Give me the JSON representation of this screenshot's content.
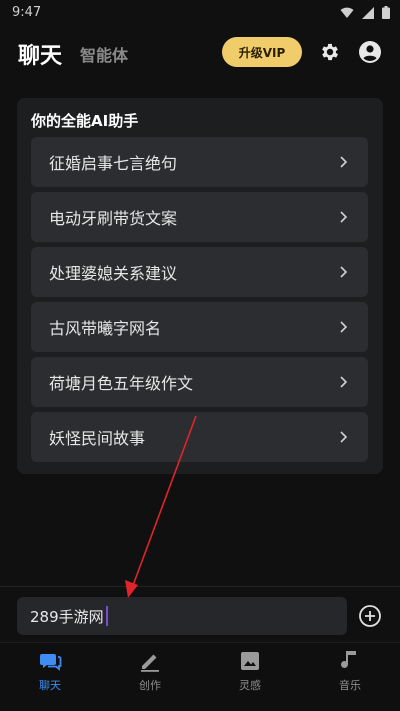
{
  "status_bar": {
    "time": "9:47"
  },
  "header": {
    "tab_chat": "聊天",
    "tab_agent": "智能体",
    "vip_label": "升级VIP"
  },
  "assistant": {
    "title": "你的全能AI助手",
    "items": [
      {
        "label": "征婚启事七言绝句"
      },
      {
        "label": "电动牙刷带货文案"
      },
      {
        "label": "处理婆媳关系建议"
      },
      {
        "label": "古风带曦字网名"
      },
      {
        "label": "荷塘月色五年级作文"
      },
      {
        "label": "妖怪民间故事"
      }
    ]
  },
  "input": {
    "value": "289手游网"
  },
  "nav": {
    "items": [
      {
        "label": "聊天",
        "icon": "chat-icon",
        "active": true
      },
      {
        "label": "创作",
        "icon": "pencil-icon",
        "active": false
      },
      {
        "label": "灵感",
        "icon": "image-icon",
        "active": false
      },
      {
        "label": "音乐",
        "icon": "music-note-icon",
        "active": false
      }
    ]
  },
  "colors": {
    "accent": "#3f8cf2",
    "vip": "#f0cd6a",
    "annotation": "#e0242b"
  }
}
